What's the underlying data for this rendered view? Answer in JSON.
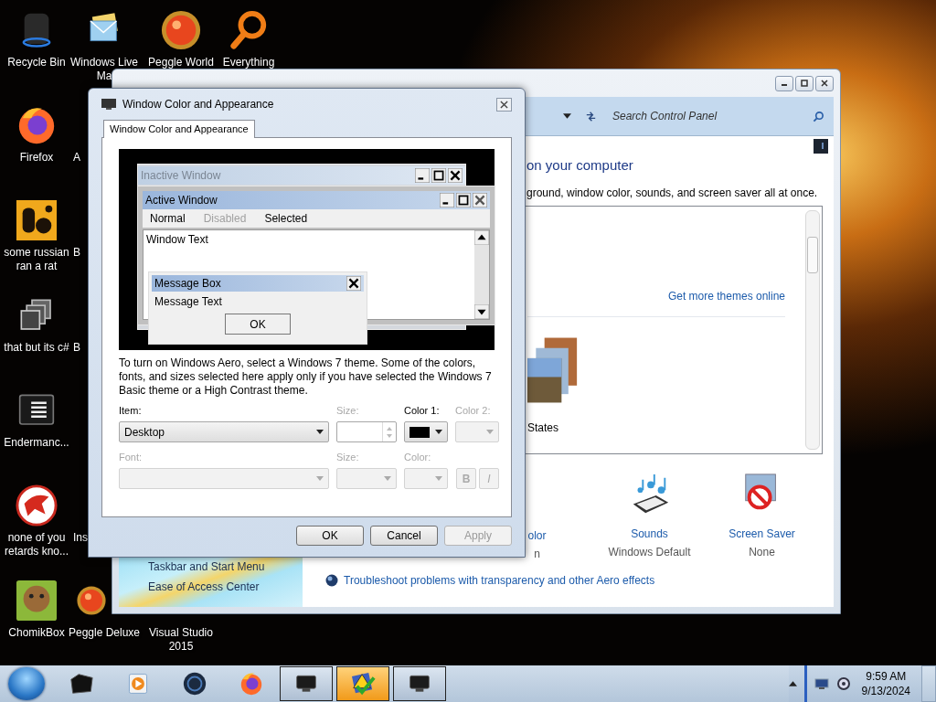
{
  "desktop_icons": [
    {
      "label": "Recycle Bin",
      "kind": "bin"
    },
    {
      "label": "Windows Live Ma",
      "kind": "mail"
    },
    {
      "label": "Peggle World",
      "kind": "peggle"
    },
    {
      "label": "Everything",
      "kind": "magnifier"
    },
    {
      "label": "Firefox",
      "kind": "firefox"
    },
    {
      "label": "A",
      "kind": "covered"
    },
    {
      "label": "some russian ran a rat",
      "kind": "tile"
    },
    {
      "label": "B",
      "kind": "covered"
    },
    {
      "label": "that but its c#",
      "kind": "stack"
    },
    {
      "label": "B",
      "kind": "covered"
    },
    {
      "label": "Endermanc...",
      "kind": "console"
    },
    {
      "label": "none of you retards kno...",
      "kind": "red-circle"
    },
    {
      "label": "Ins",
      "kind": "covered"
    },
    {
      "label": "ChomikBox",
      "kind": "hamster"
    },
    {
      "label": "Peggle Deluxe",
      "kind": "peggle"
    },
    {
      "label": "Visual Studio 2015",
      "kind": "covered"
    }
  ],
  "control_panel": {
    "search": {
      "placeholder": "Search Control Panel"
    },
    "heading": "on your computer",
    "description": "ground, window color, sounds, and screen saver all at once.",
    "themes_link": "Get more themes online",
    "theme_label": "States",
    "settings": [
      {
        "label": "olor",
        "value": "n",
        "kind": "window-color"
      },
      {
        "label": "Sounds",
        "value": "Windows Default",
        "kind": "sounds"
      },
      {
        "label": "Screen Saver",
        "value": "None",
        "kind": "screen-saver"
      }
    ],
    "sidebar_links": [
      "Taskbar and Start Menu",
      "Ease of Access Center"
    ],
    "troubleshoot_link": "Troubleshoot problems with transparency and other Aero effects"
  },
  "dialog": {
    "title": "Window Color and Appearance",
    "tabs": [
      {
        "label": "Window Color and Appearance",
        "selected": true
      }
    ],
    "preview": {
      "inactive_title": "Inactive Window",
      "active_title": "Active Window",
      "menu": [
        {
          "label": "Normal",
          "disabled": false
        },
        {
          "label": "Disabled",
          "disabled": true
        },
        {
          "label": "Selected",
          "disabled": false
        }
      ],
      "window_text": "Window Text",
      "message_box": {
        "title": "Message Box",
        "text": "Message Text",
        "button": "OK"
      }
    },
    "description": "To turn on Windows Aero, select a Windows 7 theme.  Some of the colors, fonts, and sizes selected here apply only if you have selected the Windows 7 Basic theme or a High Contrast theme.",
    "fields": [
      {
        "label": "Item:",
        "kind": "select",
        "value": "Desktop",
        "disabled": false
      },
      {
        "label": "Size:",
        "kind": "spin",
        "disabled": true
      },
      {
        "label": "Color 1:",
        "kind": "color",
        "color": "#000000",
        "disabled": false
      },
      {
        "label": "Color 2:",
        "kind": "color",
        "disabled": true
      },
      {
        "label": "Font:",
        "kind": "select",
        "disabled": true
      },
      {
        "label": "Size:",
        "kind": "select",
        "disabled": true
      },
      {
        "label": "Color:",
        "kind": "color",
        "disabled": true
      },
      {
        "label": "B",
        "kind": "bold",
        "disabled": true
      },
      {
        "label": "I",
        "kind": "italic",
        "disabled": true
      }
    ],
    "buttons": [
      {
        "label": "OK",
        "disabled": false
      },
      {
        "label": "Cancel",
        "disabled": false
      },
      {
        "label": "Apply",
        "disabled": true
      }
    ]
  },
  "taskbar": {
    "items": [
      {
        "kind": "black-box",
        "running": false,
        "selected": false
      },
      {
        "kind": "media-player",
        "running": false,
        "selected": false
      },
      {
        "kind": "globe",
        "running": false,
        "selected": false
      },
      {
        "kind": "firefox",
        "running": false,
        "selected": false
      },
      {
        "kind": "monitor",
        "running": true,
        "selected": false
      },
      {
        "kind": "warning-check",
        "running": true,
        "selected": true
      },
      {
        "kind": "monitor",
        "running": true,
        "selected": false
      }
    ],
    "clock": {
      "time": "9:59 AM",
      "date": "9/13/2024"
    }
  }
}
